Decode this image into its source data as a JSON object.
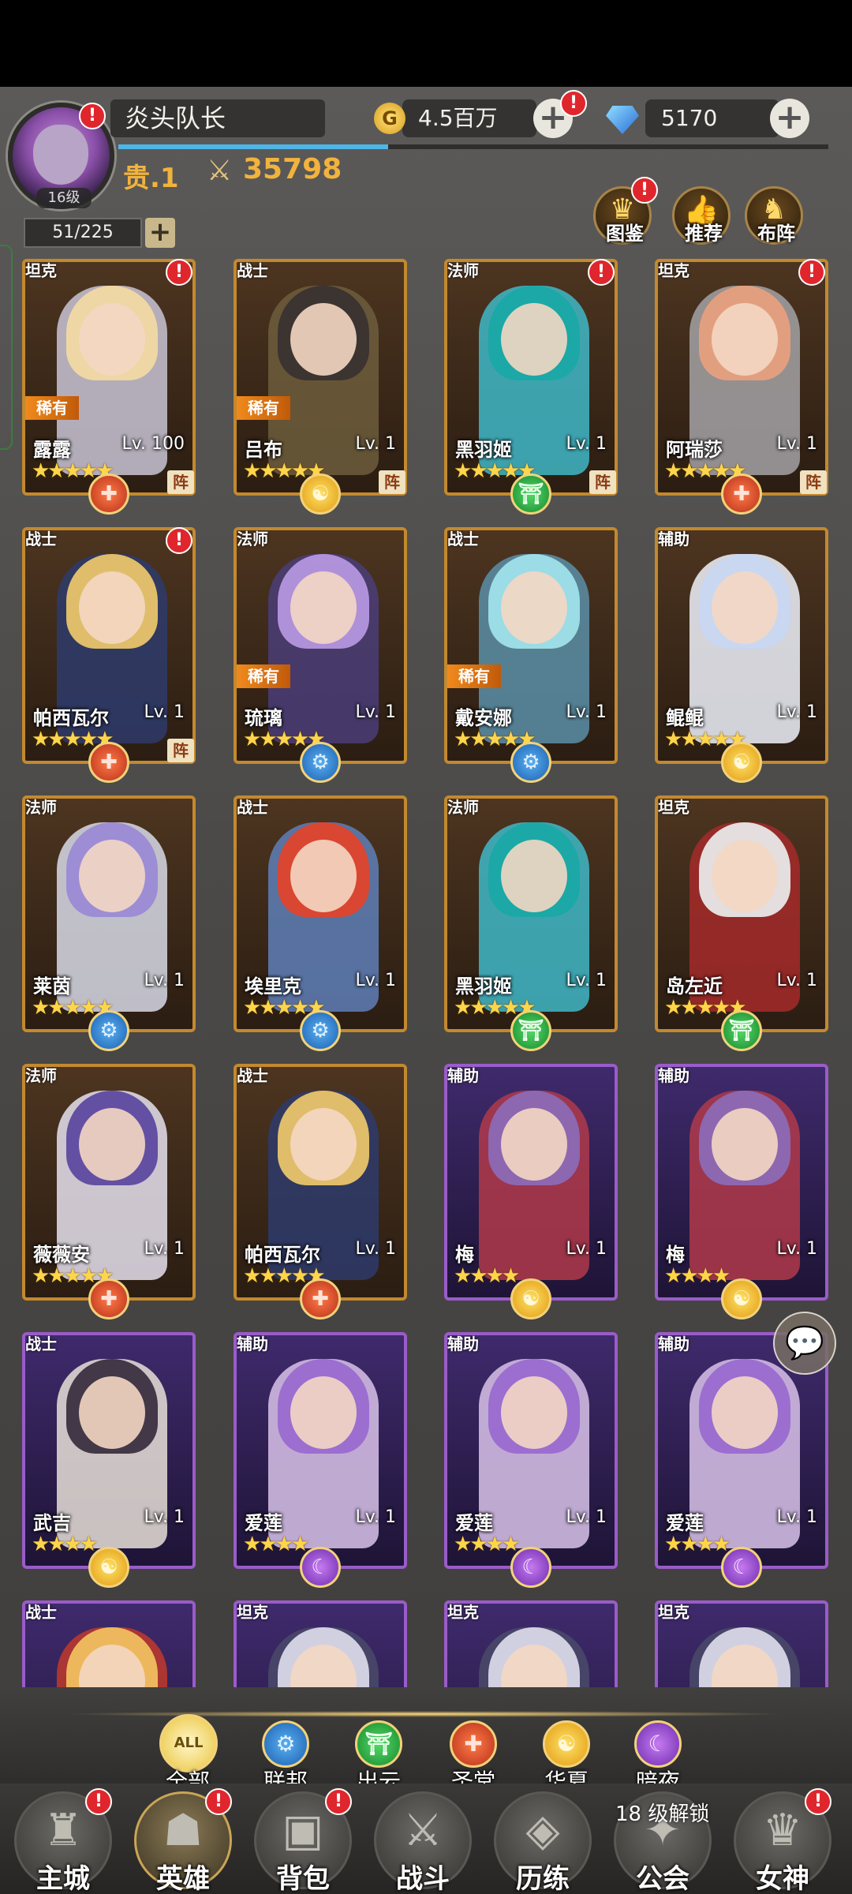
{
  "player": {
    "name": "炎头队长",
    "level": "16级",
    "rank": "贵.1",
    "power": "35798",
    "gold": "4.5百万",
    "gems": "5170",
    "hero_count": "51/225",
    "xp_progress": 0.38
  },
  "top_buttons": [
    {
      "label": "图鉴",
      "icon": "book-crown-icon"
    },
    {
      "label": "推荐",
      "icon": "thumbs-up-icon"
    },
    {
      "label": "布阵",
      "icon": "horse-icon"
    }
  ],
  "heroes": [
    {
      "name": "露露",
      "level": "Lv. 100",
      "role": "坦克",
      "rare": "稀有",
      "stars": 5,
      "faction": "shengtang",
      "formation": "阵",
      "badge": true,
      "frame": "gold",
      "hair": "#f1d9a2",
      "body": "#c9c4d6"
    },
    {
      "name": "吕布",
      "level": "Lv. 1",
      "role": "战士",
      "rare": "稀有",
      "stars": 5,
      "faction": "huaxia",
      "formation": "阵",
      "badge": false,
      "frame": "gold",
      "hair": "#3a3330",
      "body": "#6d5d3c"
    },
    {
      "name": "黑羽姬",
      "level": "Lv. 1",
      "role": "法师",
      "rare": "",
      "stars": 5,
      "faction": "chuyun",
      "formation": "阵",
      "badge": true,
      "frame": "gold",
      "hair": "#1aa9a5",
      "body": "#3fb8c8"
    },
    {
      "name": "阿瑞莎",
      "level": "Lv. 1",
      "role": "坦克",
      "rare": "",
      "stars": 5,
      "faction": "shengtang",
      "formation": "阵",
      "badge": true,
      "frame": "gold",
      "hair": "#e6a07e",
      "body": "#a4a2a6"
    },
    {
      "name": "帕西瓦尔",
      "level": "Lv. 1",
      "role": "战士",
      "rare": "",
      "stars": 5,
      "faction": "shengtang",
      "formation": "阵",
      "badge": true,
      "frame": "gold",
      "hair": "#e9c46a",
      "body": "#2e3b6c"
    },
    {
      "name": "琉璃",
      "level": "Lv. 1",
      "role": "法师",
      "rare": "稀有",
      "stars": 5,
      "faction": "lianbang",
      "formation": "",
      "badge": false,
      "frame": "gold",
      "hair": "#b596e0",
      "body": "#4a3d78"
    },
    {
      "name": "戴安娜",
      "level": "Lv. 1",
      "role": "战士",
      "rare": "稀有",
      "stars": 5,
      "faction": "lianbang",
      "formation": "",
      "badge": false,
      "frame": "gold",
      "hair": "#9fe0ea",
      "body": "#5a8fa8"
    },
    {
      "name": "鲲鲲",
      "level": "Lv. 1",
      "role": "辅助",
      "rare": "",
      "stars": 5,
      "faction": "huaxia",
      "formation": "",
      "badge": false,
      "frame": "gold",
      "hair": "#c8d7f2",
      "body": "#eef2fb"
    },
    {
      "name": "莱茵",
      "level": "Lv. 1",
      "role": "法师",
      "rare": "",
      "stars": 5,
      "faction": "lianbang",
      "formation": "",
      "badge": false,
      "frame": "gold",
      "hair": "#9b8ad6",
      "body": "#d8dbe8"
    },
    {
      "name": "埃里克",
      "level": "Lv. 1",
      "role": "战士",
      "rare": "",
      "stars": 5,
      "faction": "lianbang",
      "formation": "",
      "badge": false,
      "frame": "gold",
      "hair": "#e0432b",
      "body": "#5e7fb8"
    },
    {
      "name": "黑羽姬",
      "level": "Lv. 1",
      "role": "法师",
      "rare": "",
      "stars": 5,
      "faction": "chuyun",
      "formation": "",
      "badge": false,
      "frame": "gold",
      "hair": "#1aa9a5",
      "body": "#3fb8c8"
    },
    {
      "name": "岛左近",
      "level": "Lv. 1",
      "role": "坦克",
      "rare": "",
      "stars": 5,
      "faction": "chuyun",
      "formation": "",
      "badge": false,
      "frame": "gold",
      "hair": "#e8e8e8",
      "body": "#a52a2a"
    },
    {
      "name": "薇薇安",
      "level": "Lv. 1",
      "role": "法师",
      "rare": "",
      "stars": 5,
      "faction": "shengtang",
      "formation": "",
      "badge": false,
      "frame": "gold",
      "hair": "#5d4aa0",
      "body": "#e6e2ef"
    },
    {
      "name": "帕西瓦尔",
      "level": "Lv. 1",
      "role": "战士",
      "rare": "",
      "stars": 5,
      "faction": "shengtang",
      "formation": "",
      "badge": false,
      "frame": "gold",
      "hair": "#e9c46a",
      "body": "#2e3b6c"
    },
    {
      "name": "梅",
      "level": "Lv. 1",
      "role": "辅助",
      "rare": "",
      "stars": 4,
      "faction": "huaxia",
      "formation": "",
      "badge": false,
      "frame": "purple",
      "hair": "#8c6ab4",
      "body": "#b03a4a"
    },
    {
      "name": "梅",
      "level": "Lv. 1",
      "role": "辅助",
      "rare": "",
      "stars": 4,
      "faction": "huaxia",
      "formation": "",
      "badge": false,
      "frame": "purple",
      "hair": "#8c6ab4",
      "body": "#b03a4a"
    },
    {
      "name": "武吉",
      "level": "Lv. 1",
      "role": "战士",
      "rare": "",
      "stars": 4,
      "faction": "huaxia",
      "formation": "",
      "badge": false,
      "frame": "purple",
      "hair": "#3a3040",
      "body": "#e8e0d8"
    },
    {
      "name": "爱莲",
      "level": "Lv. 1",
      "role": "辅助",
      "rare": "",
      "stars": 4,
      "faction": "anye",
      "formation": "",
      "badge": false,
      "frame": "purple",
      "hair": "#9a6ad0",
      "body": "#d9c3ea"
    },
    {
      "name": "爱莲",
      "level": "Lv. 1",
      "role": "辅助",
      "rare": "",
      "stars": 4,
      "faction": "anye",
      "formation": "",
      "badge": false,
      "frame": "purple",
      "hair": "#9a6ad0",
      "body": "#d9c3ea"
    },
    {
      "name": "爱莲",
      "level": "Lv. 1",
      "role": "辅助",
      "rare": "",
      "stars": 4,
      "faction": "anye",
      "formation": "",
      "badge": false,
      "frame": "purple",
      "hair": "#9a6ad0",
      "body": "#d9c3ea"
    },
    {
      "name": "",
      "level": "",
      "role": "战士",
      "rare": "",
      "stars": 0,
      "faction": "",
      "formation": "",
      "badge": false,
      "frame": "purple",
      "hair": "#f0c060",
      "body": "#c0392b"
    },
    {
      "name": "",
      "level": "",
      "role": "坦克",
      "rare": "",
      "stars": 0,
      "faction": "",
      "formation": "",
      "badge": false,
      "frame": "purple",
      "hair": "#d8d8e8",
      "body": "#4a4a6a"
    },
    {
      "name": "",
      "level": "",
      "role": "坦克",
      "rare": "",
      "stars": 0,
      "faction": "",
      "formation": "",
      "badge": false,
      "frame": "purple",
      "hair": "#d8d8e8",
      "body": "#4a4a6a"
    },
    {
      "name": "",
      "level": "",
      "role": "坦克",
      "rare": "",
      "stars": 0,
      "faction": "",
      "formation": "",
      "badge": false,
      "frame": "purple",
      "hair": "#d8d8e8",
      "body": "#4a4a6a"
    }
  ],
  "faction_glyphs": {
    "lianbang": "⚙",
    "chuyun": "⛩",
    "shengtang": "✚",
    "huaxia": "☯",
    "anye": "☾"
  },
  "filters": [
    {
      "key": "all",
      "label": "全部",
      "glyph": "ALL"
    },
    {
      "key": "lianbang",
      "label": "联邦",
      "glyph": "⚙"
    },
    {
      "key": "chuyun",
      "label": "出云",
      "glyph": "⛩"
    },
    {
      "key": "shengtang",
      "label": "圣堂",
      "glyph": "✚"
    },
    {
      "key": "huaxia",
      "label": "华夏",
      "glyph": "☯"
    },
    {
      "key": "anye",
      "label": "暗夜",
      "glyph": "☾"
    }
  ],
  "nav": [
    {
      "label": "主城",
      "icon": "castle-icon",
      "glyph": "♜",
      "badge": true
    },
    {
      "label": "英雄",
      "icon": "hood-icon",
      "glyph": "☗",
      "badge": true,
      "active": true
    },
    {
      "label": "背包",
      "icon": "backpack-icon",
      "glyph": "▣",
      "badge": true
    },
    {
      "label": "战斗",
      "icon": "crossed-swords-icon",
      "glyph": "⚔",
      "badge": false
    },
    {
      "label": "历练",
      "icon": "map-icon",
      "glyph": "◈",
      "badge": false
    },
    {
      "label": "公会",
      "icon": "guild-icon",
      "glyph": "✦",
      "badge": false
    },
    {
      "label": "女神",
      "icon": "goddess-icon",
      "glyph": "♛",
      "badge": true
    }
  ],
  "guild_lock": {
    "level": "18",
    "text": "级解锁"
  },
  "chat_icon": "chat-bubble-icon"
}
